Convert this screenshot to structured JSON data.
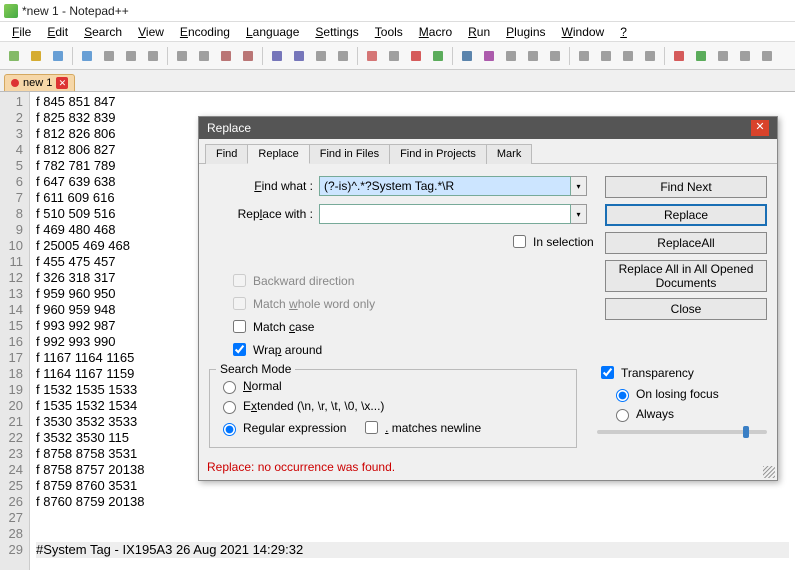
{
  "title": "*new 1 - Notepad++",
  "menus": [
    "File",
    "Edit",
    "Search",
    "View",
    "Encoding",
    "Language",
    "Settings",
    "Tools",
    "Macro",
    "Run",
    "Plugins",
    "Window",
    "?"
  ],
  "file_tab": {
    "label": "new 1"
  },
  "lines": [
    "f 845 851 847",
    "f 825 832 839",
    "f 812 826 806",
    "f 812 806 827",
    "f 782 781 789",
    "f 647 639 638",
    "f 611 609 616",
    "f 510 509 516",
    "f 469 480 468",
    "f 25005 469 468",
    "f 455 475 457",
    "f 326 318 317",
    "f 959 960 950",
    "f 960 959 948",
    "f 993 992 987",
    "f 992 993 990",
    "f 1167 1164 1165",
    "f 1164 1167 1159",
    "f 1532 1535 1533",
    "f 1535 1532 1534",
    "f 3530 3532 3533",
    "f 3532 3530 115",
    "f 8758 8758 3531",
    "f 8758 8757 20138",
    "f 8759 8760 3531",
    "f 8760 8759 20138",
    "",
    "",
    "#System Tag - IX195A3 26 Aug 2021 14:29:32"
  ],
  "dialog": {
    "title": "Replace",
    "tabs": [
      "Find",
      "Replace",
      "Find in Files",
      "Find in Projects",
      "Mark"
    ],
    "active_tab": 1,
    "find_label": "Find what :",
    "replace_label": "Replace with :",
    "find_value": "(?-is)^.*?System Tag.*\\R",
    "replace_value": "",
    "buttons": {
      "find_next": "Find Next",
      "replace": "Replace",
      "replace_all": "Replace All",
      "replace_all_opened": "Replace All in All Opened Documents",
      "close": "Close"
    },
    "in_selection": "In selection",
    "options": {
      "backward": "Backward direction",
      "whole_word": "Match whole word only",
      "match_case": "Match case",
      "wrap": "Wrap around",
      "wrap_checked": true
    },
    "search_mode": {
      "legend": "Search Mode",
      "normal": "Normal",
      "extended": "Extended (\\n, \\r, \\t, \\0, \\x...)",
      "regex": "Regular expression",
      "matches_newline": ". matches newline",
      "selected": "regex"
    },
    "transparency": {
      "label": "Transparency",
      "on_losing_focus": "On losing focus",
      "always": "Always",
      "selected": "on_losing_focus",
      "checked": true
    },
    "status": "Replace: no occurrence was found."
  }
}
